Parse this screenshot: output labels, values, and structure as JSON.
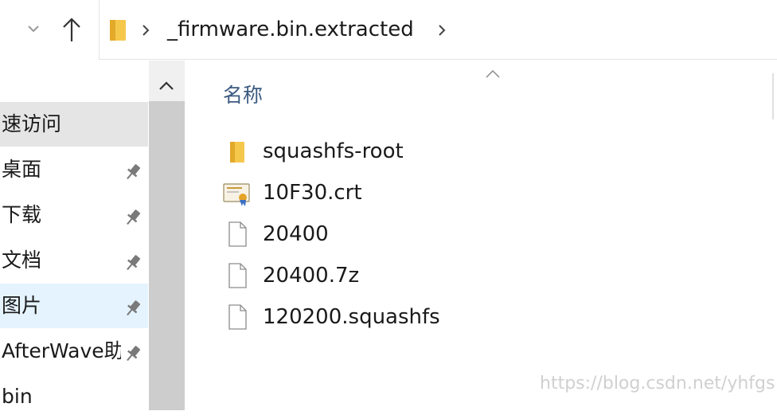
{
  "address_bar": {
    "breadcrumb": "_firmware.bin.extracted",
    "icons": [
      "chevron-down-icon",
      "up-arrow-icon",
      "folder-icon",
      "chevron-right-icon"
    ]
  },
  "nav_pane": {
    "items": [
      {
        "label": "速访问",
        "pinned": false,
        "state": "selected"
      },
      {
        "label": "桌面",
        "pinned": true,
        "state": "normal"
      },
      {
        "label": "下载",
        "pinned": true,
        "state": "normal"
      },
      {
        "label": "文档",
        "pinned": true,
        "state": "normal"
      },
      {
        "label": "图片",
        "pinned": true,
        "state": "hover"
      },
      {
        "label": "AfterWave助",
        "pinned": true,
        "state": "normal"
      },
      {
        "label": "bin",
        "pinned": false,
        "state": "normal"
      }
    ]
  },
  "content": {
    "column_header": "名称",
    "files": [
      {
        "name": "squashfs-root",
        "icon": "folder-icon"
      },
      {
        "name": "10F30.crt",
        "icon": "certificate-icon"
      },
      {
        "name": "20400",
        "icon": "file-icon"
      },
      {
        "name": "20400.7z",
        "icon": "file-icon"
      },
      {
        "name": "120200.squashfs",
        "icon": "file-icon"
      }
    ]
  },
  "watermark": "https://blog.csdn.net/yhfgs",
  "colors": {
    "accent_header": "#3c5a80",
    "folder_yellow": "#f5c84c",
    "selected_bg": "#e5e5e5",
    "hover_bg": "#e5f3ff"
  }
}
